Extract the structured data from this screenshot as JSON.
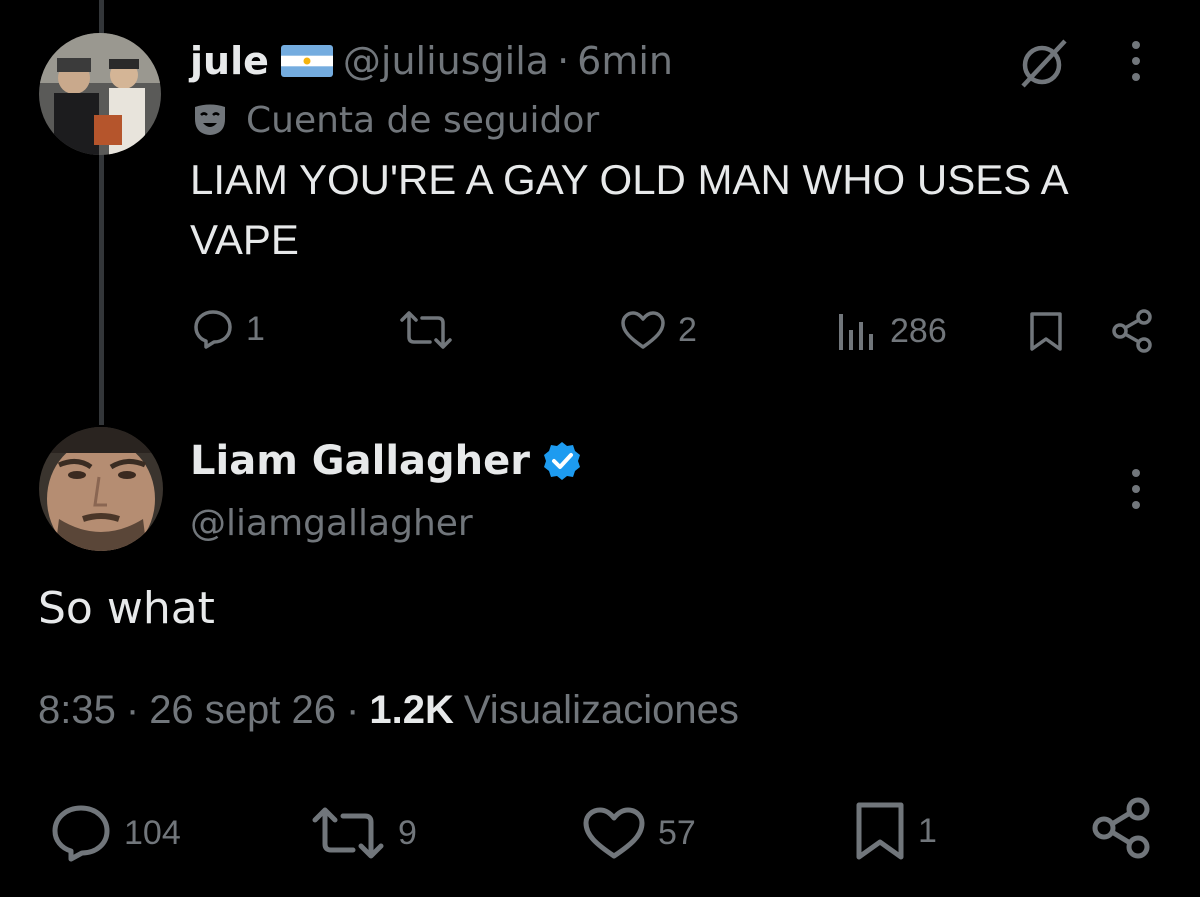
{
  "reply": {
    "display_name": "jule",
    "handle": "@juliusgila",
    "separator": "·",
    "time": "6min",
    "account_label": "Cuenta de seguidor",
    "text": "LIAM YOU'RE A GAY OLD MAN WHO USES A VAPE",
    "actions": {
      "replies": "1",
      "likes": "2",
      "views": "286"
    }
  },
  "tweet": {
    "display_name": "Liam Gallagher",
    "handle": "@liamgallagher",
    "text": "So what",
    "time": "8:35",
    "date": "26 sept 26",
    "sep": "·",
    "views_count": "1.2K",
    "views_label": "Visualizaciones",
    "actions": {
      "replies": "104",
      "reposts": "9",
      "likes": "57",
      "bookmarks": "1"
    }
  },
  "colors": {
    "background": "#000000",
    "text": "#e7e9ea",
    "muted": "#71767b",
    "verified": "#1d9bf0",
    "thread_line": "#333639"
  }
}
